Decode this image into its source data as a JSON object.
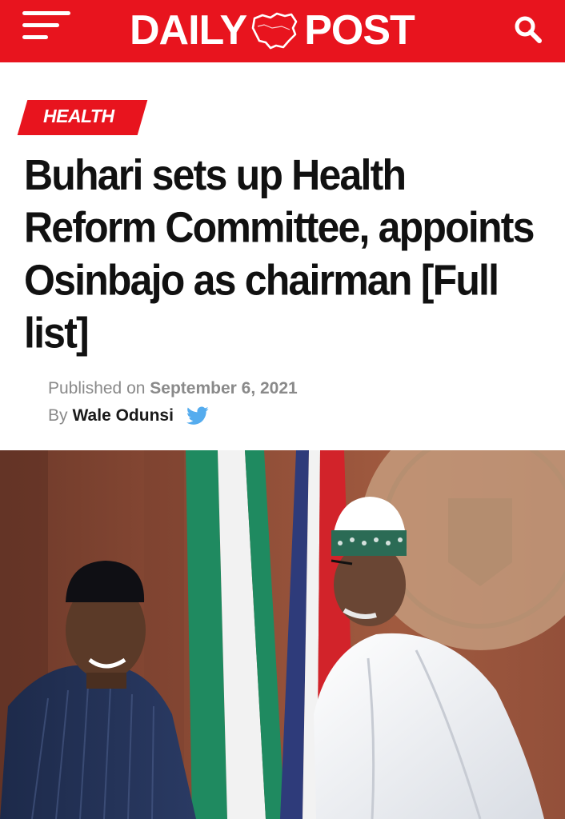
{
  "header": {
    "logo_left": "DAILY",
    "logo_right": "POST",
    "icons": [
      "hamburger-menu-icon",
      "nigeria-map-icon",
      "search-icon"
    ],
    "brand_color": "#e8141e"
  },
  "article": {
    "category": "HEALTH",
    "title": "Buhari sets up Health Reform Committee, appoints Osinbajo as chairman [Full list]",
    "published_label": "Published on",
    "published_date": "September 6, 2021",
    "by_label": "By",
    "author": "Wale Odunsi",
    "author_icon": "twitter-icon"
  }
}
